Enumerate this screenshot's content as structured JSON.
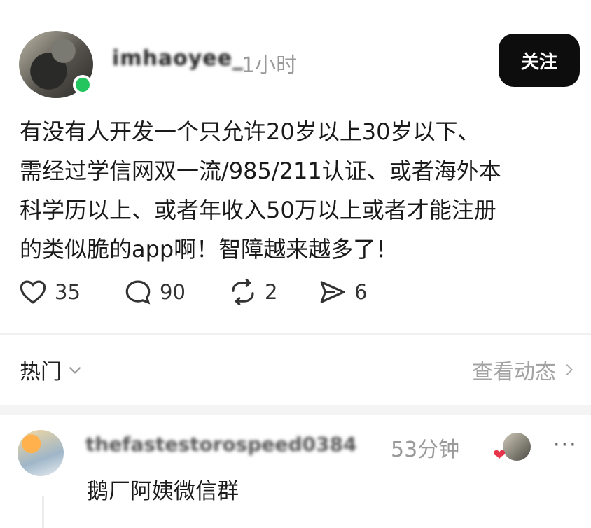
{
  "post": {
    "username": "imhaoyee_",
    "time_ago": "1小时",
    "follow_label": "关注",
    "text_lines": [
      "有没有人开发一个只允许20岁以上30岁以下、",
      "需经过学信网双一流/985/211认证、或者海外本",
      "科学历以上、或者年收入50万以上或者才能注册",
      "的类似脆的app啊！智障越来越多了！"
    ],
    "actions": {
      "likes": "35",
      "comments": "90",
      "reposts": "2",
      "shares": "6"
    }
  },
  "comments_section": {
    "sort_label": "热门",
    "view_activity_label": "查看动态",
    "comment": {
      "username": "thefastestorospeed0384",
      "time_ago": "53分钟",
      "text": "鹅厂阿姨微信群",
      "more_label": "···"
    }
  },
  "icons": {
    "like": "heart-icon",
    "comment": "comment-bubble-icon",
    "repost": "repost-icon",
    "share": "send-icon",
    "chevron_down": "chevron-down-icon",
    "chevron_right": "chevron-right-icon"
  },
  "colors": {
    "online": "#22c55e",
    "follow_bg": "#0d0d0d",
    "heart_red": "#e8344b"
  }
}
